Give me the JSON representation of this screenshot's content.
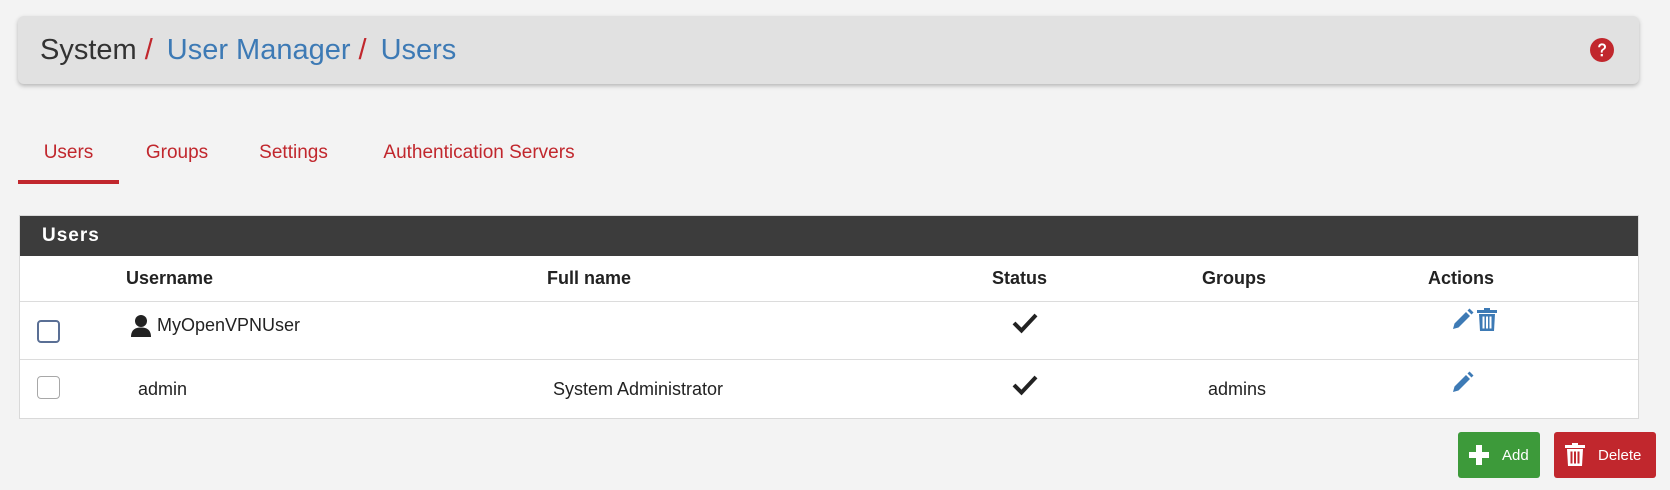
{
  "breadcrumb": {
    "root": "System",
    "sep1": "/",
    "link1": "User Manager",
    "sep2": "/",
    "link2": "Users"
  },
  "tabs": [
    {
      "label": "Users",
      "active": true
    },
    {
      "label": "Groups",
      "active": false
    },
    {
      "label": "Settings",
      "active": false
    },
    {
      "label": "Authentication Servers",
      "active": false
    }
  ],
  "panel": {
    "title": "Users",
    "columns": {
      "username": "Username",
      "fullname": "Full name",
      "status": "Status",
      "groups": "Groups",
      "actions": "Actions"
    },
    "rows": [
      {
        "username": "MyOpenVPNUser",
        "fullname": "",
        "status": "enabled",
        "groups": "",
        "actions": [
          "edit",
          "delete"
        ],
        "user_icon": "user-icon"
      },
      {
        "username": "admin",
        "fullname": "System Administrator",
        "status": "enabled",
        "groups": "admins",
        "actions": [
          "edit"
        ]
      }
    ]
  },
  "buttons": {
    "add": "Add",
    "delete": "Delete"
  },
  "colors": {
    "accent_red": "#c1272d",
    "link_blue": "#3d7ab5",
    "add_green": "#3d9a3a",
    "panel_heading": "#3c3c3c"
  }
}
